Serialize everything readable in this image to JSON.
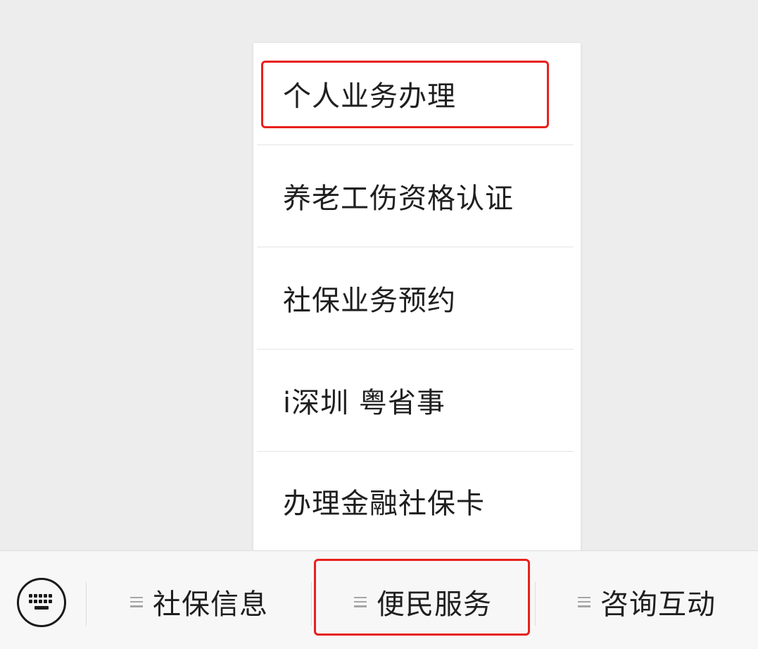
{
  "submenu": {
    "items": [
      {
        "label": "个人业务办理"
      },
      {
        "label": "养老工伤资格认证"
      },
      {
        "label": "社保业务预约"
      },
      {
        "label": "i深圳 粤省事"
      },
      {
        "label": "办理金融社保卡"
      }
    ]
  },
  "menubar": {
    "keyboard_icon": "keyboard-icon",
    "tabs": [
      {
        "label": "社保信息",
        "icon": "menu-lines-icon"
      },
      {
        "label": "便民服务",
        "icon": "menu-lines-icon"
      },
      {
        "label": "咨询互动",
        "icon": "menu-lines-icon"
      }
    ]
  },
  "colors": {
    "highlight": "#e8201c",
    "background": "#ededed",
    "menubar": "#f7f7f7",
    "submenu": "#ffffff"
  }
}
